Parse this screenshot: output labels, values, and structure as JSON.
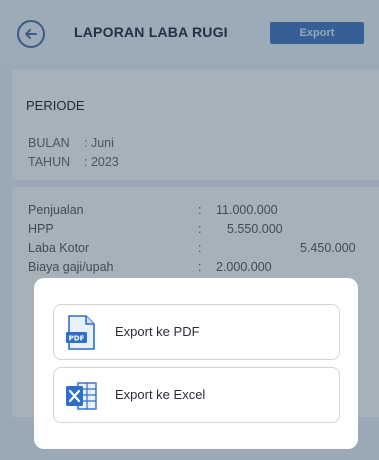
{
  "header": {
    "title": "LAPORAN LABA RUGI",
    "export_label": "Export"
  },
  "periode": {
    "title": "PERIODE",
    "bulan_label": "BULAN",
    "bulan_value": ": Juni",
    "tahun_label": "TAHUN",
    "tahun_value": ": 2023"
  },
  "report": {
    "rows": [
      {
        "label": "Penjualan",
        "colon": ":",
        "value1": "11.000.000",
        "value2": ""
      },
      {
        "label": "HPP",
        "colon": ":",
        "value1": "5.550.000",
        "value2": ""
      },
      {
        "label": "Laba Kotor",
        "colon": ":",
        "value1": "",
        "value2": "5.450.000"
      },
      {
        "label": "Biaya gaji/upah",
        "colon": ":",
        "value1": "2.000.000",
        "value2": ""
      }
    ]
  },
  "dialog": {
    "pdf_label": "Export ke PDF",
    "excel_label": "Export ke Excel"
  },
  "colors": {
    "accent": "#3f74c5",
    "pdf": "#2f6fc9",
    "excel": "#2f6fc9"
  }
}
